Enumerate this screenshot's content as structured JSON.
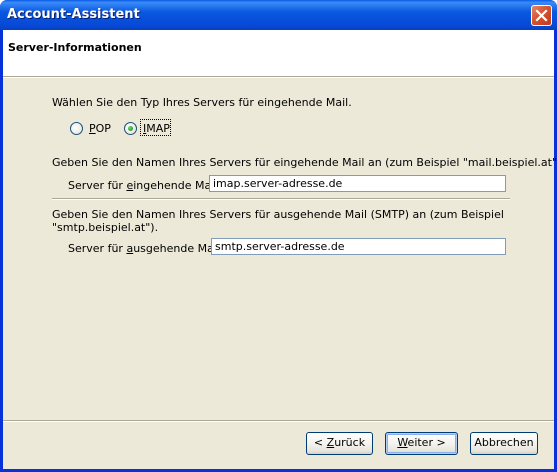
{
  "window": {
    "title": "Account-Assistent",
    "close_icon": "close-icon"
  },
  "header": {
    "title": "Server-Informationen"
  },
  "server_type": {
    "prompt": "Wählen Sie den Typ Ihres Servers für eingehende Mail.",
    "options": [
      {
        "label_pre": "",
        "label_ul": "P",
        "label_post": "OP",
        "selected": false
      },
      {
        "label_pre": "",
        "label_ul": "I",
        "label_post": "MAP",
        "selected": true
      }
    ]
  },
  "incoming": {
    "description": "Geben Sie den Namen Ihres Servers für eingehende Mail an (zum Beispiel \"mail.beispiel.at\").",
    "label_pre": "Server für ",
    "label_ul": "e",
    "label_post": "ingehende Mail:",
    "value": "imap.server-adresse.de"
  },
  "outgoing": {
    "description_line1": "Geben Sie den Namen Ihres Servers für ausgehende Mail (SMTP) an (zum Beispiel",
    "description_line2": "\"smtp.beispiel.at\").",
    "label_pre": "Server für ",
    "label_ul": "a",
    "label_post": "usgehende Mail:",
    "value": "smtp.server-adresse.de"
  },
  "buttons": {
    "back_pre": "< ",
    "back_ul": "Z",
    "back_post": "urück",
    "next_pre": "",
    "next_ul": "W",
    "next_post": "eiter >",
    "cancel": "Abbrechen"
  },
  "colors": {
    "titlebar": "#0a58e0",
    "dialog_face": "#ece9d8",
    "radio_dot": "#2c9a2c",
    "field_border": "#7f9db9",
    "close_button": "#d4532f"
  }
}
